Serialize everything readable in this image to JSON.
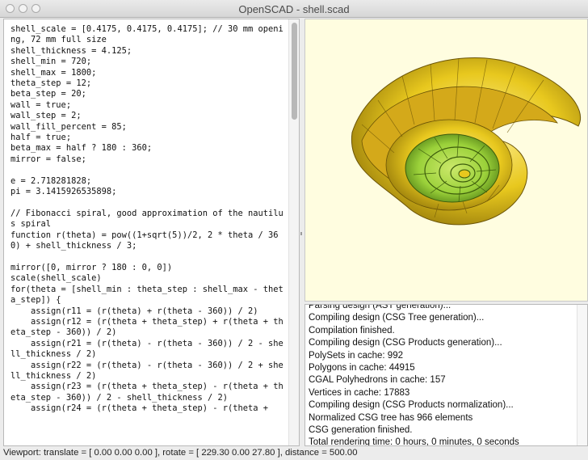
{
  "window": {
    "title": "OpenSCAD - shell.scad"
  },
  "editor": {
    "code": "shell_scale = [0.4175, 0.4175, 0.4175]; // 30 mm opening, 72 mm full size\nshell_thickness = 4.125;\nshell_min = 720;\nshell_max = 1800;\ntheta_step = 12;\nbeta_step = 20;\nwall = true;\nwall_step = 2;\nwall_fill_percent = 85;\nhalf = true;\nbeta_max = half ? 180 : 360;\nmirror = false;\n\ne = 2.718281828;\npi = 3.1415926535898;\n\n// Fibonacci spiral, good approximation of the nautilus spiral\nfunction r(theta) = pow((1+sqrt(5))/2, 2 * theta / 360) + shell_thickness / 3;\n\nmirror([0, mirror ? 180 : 0, 0])\nscale(shell_scale)\nfor(theta = [shell_min : theta_step : shell_max - theta_step]) {\n    assign(r11 = (r(theta) + r(theta - 360)) / 2)\n    assign(r12 = (r(theta + theta_step) + r(theta + theta_step - 360)) / 2)\n    assign(r21 = (r(theta) - r(theta - 360)) / 2 - shell_thickness / 2)\n    assign(r22 = (r(theta) - r(theta - 360)) / 2 + shell_thickness / 2)\n    assign(r23 = (r(theta + theta_step) - r(theta + theta_step - 360)) / 2 - shell_thickness / 2)\n    assign(r24 = (r(theta + theta_step) - r(theta +"
  },
  "console": {
    "lines": [
      "Parsing design (AST generation)...",
      "Compiling design (CSG Tree generation)...",
      "Compilation finished.",
      "Compiling design (CSG Products generation)...",
      "PolySets in cache: 992",
      "Polygons in cache: 44915",
      "CGAL Polyhedrons in cache: 157",
      "Vertices in cache: 17883",
      "Compiling design (CSG Products normalization)...",
      "Normalized CSG tree has 966 elements",
      "CSG generation finished.",
      "Total rendering time: 0 hours, 0 minutes, 0 seconds"
    ]
  },
  "status": {
    "text": "Viewport: translate = [ 0.00 0.00 0.00 ], rotate = [ 229.30 0.00 27.80 ], distance = 500.00"
  },
  "colors": {
    "viewport_bg": "#fffde0",
    "shell_outer": "#e8c81e",
    "shell_inner": "#9bd13a"
  }
}
